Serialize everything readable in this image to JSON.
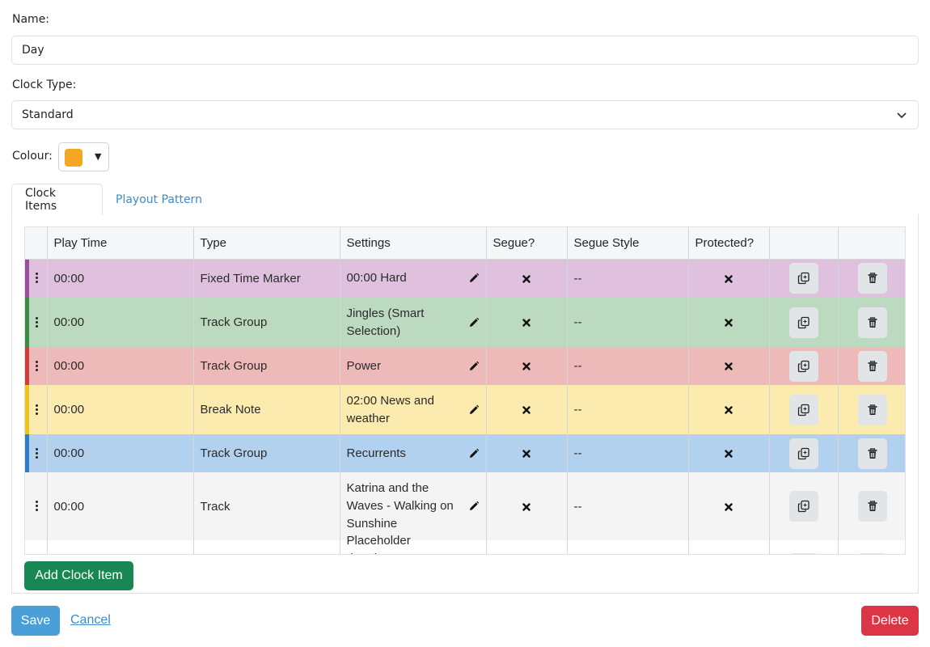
{
  "form": {
    "name_label": "Name:",
    "name_value": "Day",
    "clock_type_label": "Clock Type:",
    "clock_type_value": "Standard",
    "colour_label": "Colour:",
    "colour_value": "#f5a623"
  },
  "tabs": [
    {
      "label": "Clock Items",
      "active": true
    },
    {
      "label": "Playout Pattern",
      "active": false
    }
  ],
  "table": {
    "headers": [
      "",
      "Play Time",
      "Type",
      "Settings",
      "Segue?",
      "Segue Style",
      "Protected?",
      "",
      ""
    ],
    "rows": [
      {
        "play_time": "00:00",
        "type": "Fixed Time Marker",
        "settings": "00:00 Hard",
        "segue_style": "--",
        "bg": "#dfc1df",
        "stripe": "#9b4f9b"
      },
      {
        "play_time": "00:00",
        "type": "Track Group",
        "settings": "Jingles (Smart Selection)",
        "segue_style": "--",
        "bg": "#bcdabf",
        "stripe": "#3d8b44"
      },
      {
        "play_time": "00:00",
        "type": "Track Group",
        "settings": "Power",
        "segue_style": "--",
        "bg": "#edb9b9",
        "stripe": "#d43c3c"
      },
      {
        "play_time": "00:00",
        "type": "Break Note",
        "settings": "02:00 News and weather",
        "segue_style": "--",
        "bg": "#fcebaf",
        "stripe": "#f2c21a"
      },
      {
        "play_time": "00:00",
        "type": "Track Group",
        "settings": "Recurrents",
        "segue_style": "--",
        "bg": "#b1d1ef",
        "stripe": "#2f7ccf"
      },
      {
        "play_time": "00:00",
        "type": "Track",
        "settings": "Katrina and the Waves - Walking on Sunshine",
        "segue_style": "--",
        "bg": "#f4f4f4",
        "stripe": "#f4f4f4"
      },
      {
        "play_time": "",
        "type": "",
        "settings": "Placeholder duration:",
        "segue_style": "",
        "bg": "#ffffff",
        "stripe": "#ffffff"
      }
    ]
  },
  "buttons": {
    "add": "Add Clock Item",
    "save": "Save",
    "cancel": "Cancel",
    "delete": "Delete"
  }
}
